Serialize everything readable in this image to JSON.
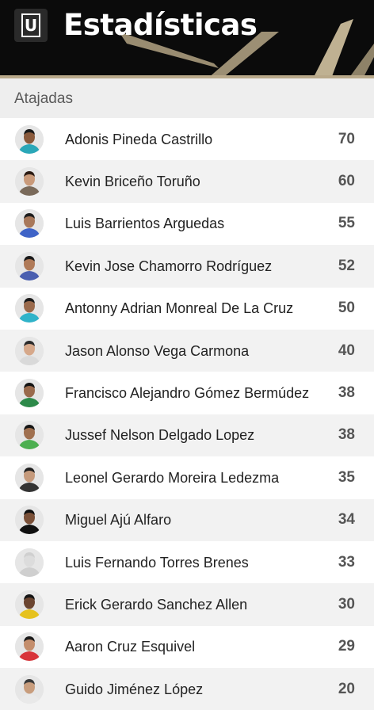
{
  "header": {
    "title": "Estadísticas",
    "logo_letter": "U"
  },
  "section": {
    "title": "Atajadas"
  },
  "colors": {
    "header_bg": "#0b0b0b",
    "gold": "#b9a98a",
    "section_bg": "#eeeeee"
  },
  "players": [
    {
      "name": "Adonis Pineda Castrillo",
      "value": "70",
      "shirt": "#2aa7b8",
      "skin": "#8a5a3c",
      "hair": "#1a1a1a"
    },
    {
      "name": "Kevin Briceño Toruño",
      "value": "60",
      "shirt": "#7a6a5a",
      "skin": "#c99a7a",
      "hair": "#2a1a12"
    },
    {
      "name": "Luis Barrientos Arguedas",
      "value": "55",
      "shirt": "#3e63c7",
      "skin": "#a8785a",
      "hair": "#1d1d1d"
    },
    {
      "name": "Kevin Jose Chamorro Rodríguez",
      "value": "52",
      "shirt": "#4a5fb0",
      "skin": "#b07a58",
      "hair": "#1a1a1a"
    },
    {
      "name": "Antonny Adrian Monreal De La Cruz",
      "value": "50",
      "shirt": "#2fb3c9",
      "skin": "#9a6a4c",
      "hair": "#1a1a1a"
    },
    {
      "name": "Jason Alonso Vega Carmona",
      "value": "40",
      "shirt": "#d9d9d9",
      "skin": "#d6a88a",
      "hair": "#2a2a2a"
    },
    {
      "name": "Francisco Alejandro Gómez Bermúdez",
      "value": "38",
      "shirt": "#2d8a4a",
      "skin": "#9a6a4c",
      "hair": "#141414"
    },
    {
      "name": "Jussef Nelson Delgado Lopez",
      "value": "38",
      "shirt": "#4caf50",
      "skin": "#a0704f",
      "hair": "#151515"
    },
    {
      "name": "Leonel Gerardo Moreira Ledezma",
      "value": "35",
      "shirt": "#333333",
      "skin": "#c59a7c",
      "hair": "#1f1f1f"
    },
    {
      "name": "Miguel Ajú Alfaro",
      "value": "34",
      "shirt": "#111111",
      "skin": "#7a5038",
      "hair": "#101010"
    },
    {
      "name": "Luis Fernando Torres Brenes",
      "value": "33",
      "shirt": "#cfcfcf",
      "skin": "#dcdcdc",
      "hair": "#cfcfcf"
    },
    {
      "name": "Erick Gerardo Sanchez Allen",
      "value": "30",
      "shirt": "#e6c21e",
      "skin": "#6b4530",
      "hair": "#141414"
    },
    {
      "name": "Aaron Cruz Esquivel",
      "value": "29",
      "shirt": "#d8343a",
      "skin": "#c48e6c",
      "hair": "#1a1a1a"
    },
    {
      "name": "Guido Jiménez López",
      "value": "20",
      "shirt": "#e9e9e9",
      "skin": "#c89d7d",
      "hair": "#3a3a3a"
    }
  ]
}
